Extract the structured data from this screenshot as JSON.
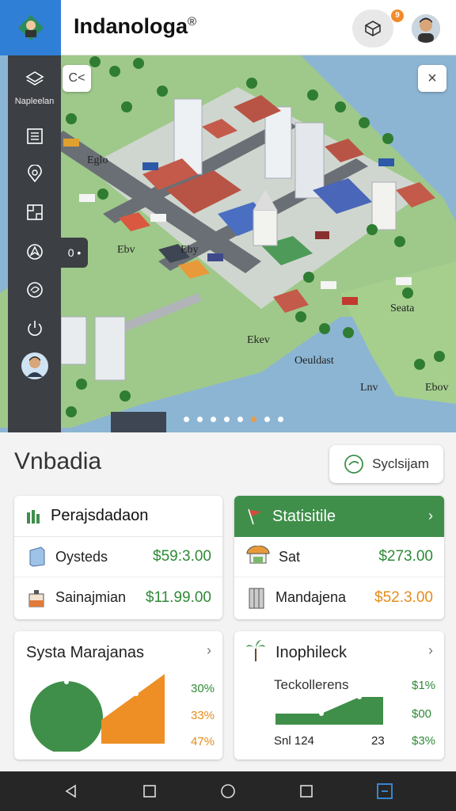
{
  "app": {
    "title": "Indanologa",
    "mark": "®",
    "notification_count": "9"
  },
  "sidebar": {
    "label": "Napleelan",
    "badge": "0"
  },
  "map": {
    "control_label": "C<",
    "close_label": "×",
    "place_labels": [
      "Eglo",
      "Ebv",
      "Eby",
      "Ekev",
      "Oeuldast",
      "Seata",
      "Lnv",
      "Ebov"
    ],
    "carousel": {
      "count": 8,
      "active_index": 5
    }
  },
  "section": {
    "title": "Vnbadia",
    "sync_label": "Syclsijam"
  },
  "cards": {
    "left": {
      "header": "Perajsdadaon",
      "rows": [
        {
          "label": "Oysteds",
          "price": "$59:3.00"
        },
        {
          "label": "Sainajmian",
          "price": "$11.99.00"
        }
      ]
    },
    "right": {
      "header": "Statisitile",
      "rows": [
        {
          "label": "Sat",
          "price": "$273.00"
        },
        {
          "label": "Mandajena",
          "price": "$52.3.00"
        }
      ]
    },
    "bottom_left": {
      "header": "Systa Marajanas",
      "percents": [
        "30%",
        "33%",
        "47%"
      ]
    },
    "bottom_right": {
      "header": "Inophileck",
      "subtitle": "Teckollerens",
      "values": [
        "$1%",
        "$00",
        "$3%"
      ],
      "footer_left": "Snl 124",
      "footer_mid": "23"
    }
  },
  "colors": {
    "brand_blue": "#2f7fd6",
    "accent_green": "#3f8f4a",
    "accent_orange": "#f28b2b",
    "price_green": "#2f8a37",
    "price_orange": "#e58c1c"
  }
}
